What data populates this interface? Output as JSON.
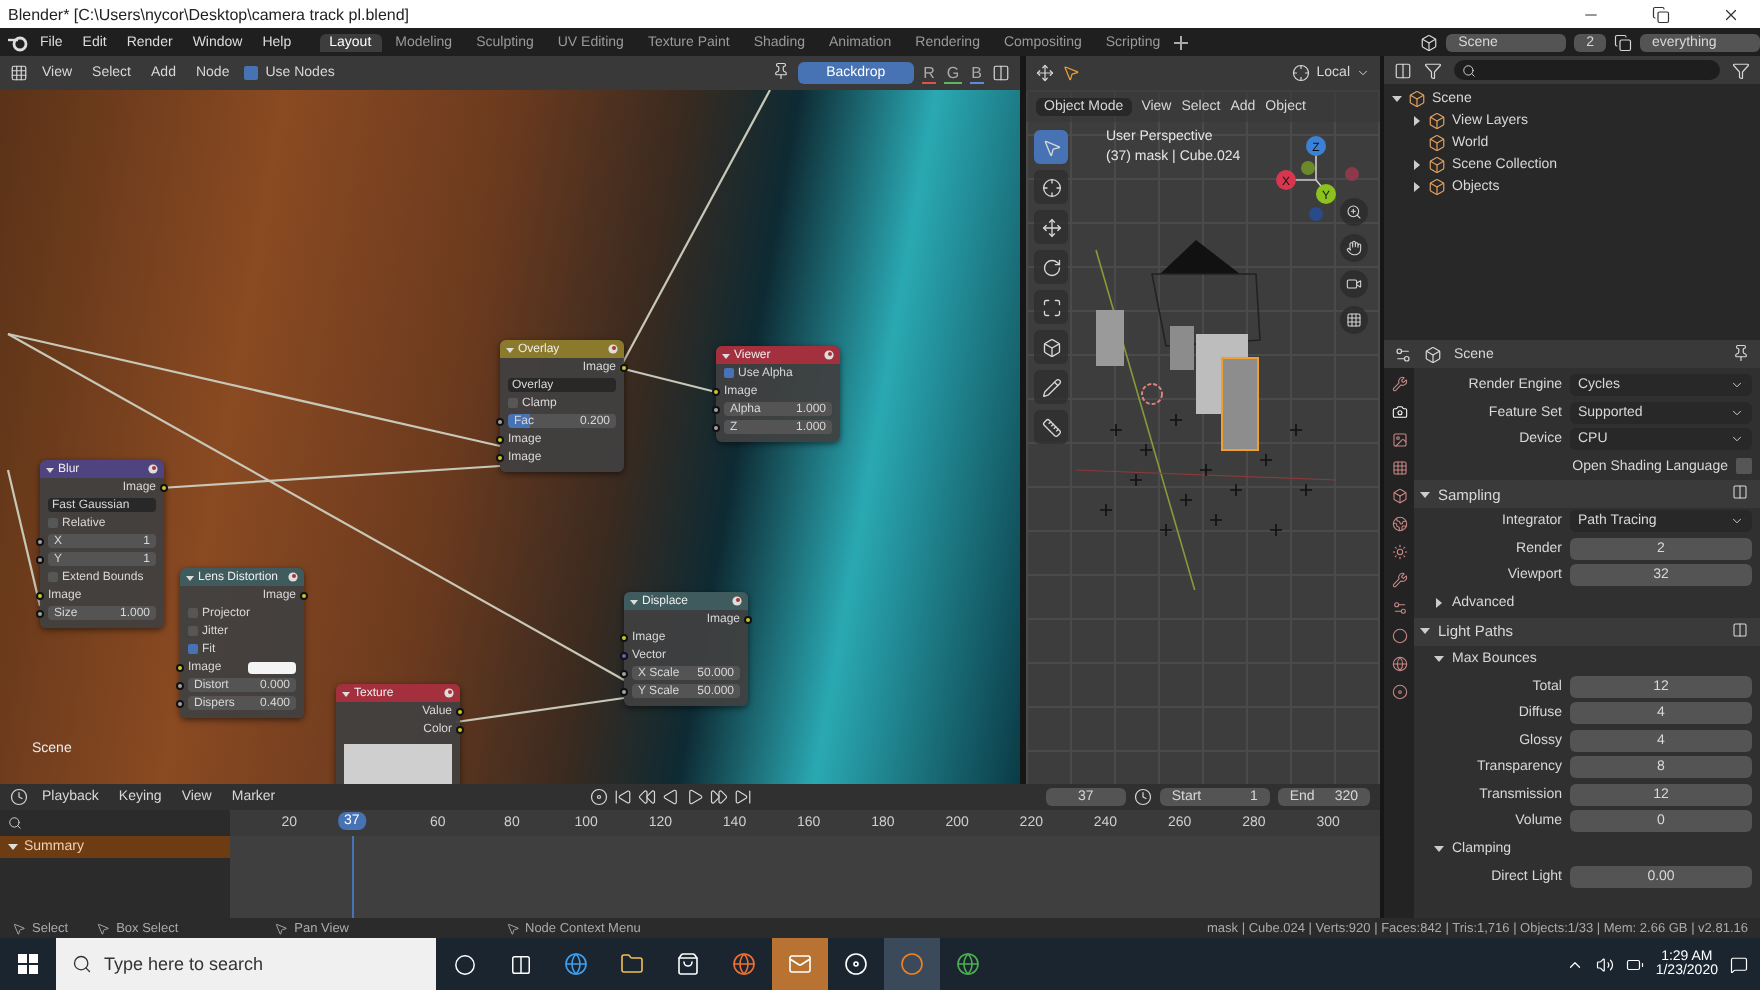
{
  "title_bar": {
    "title": "Blender* [C:\\Users\\nycor\\Desktop\\camera track pl.blend]"
  },
  "menu_bar": {
    "menus": [
      "File",
      "Edit",
      "Render",
      "Window",
      "Help"
    ],
    "workspaces": [
      {
        "label": "Layout",
        "selected": true
      },
      {
        "label": "Modeling",
        "selected": false
      },
      {
        "label": "Sculpting",
        "selected": false
      },
      {
        "label": "UV Editing",
        "selected": false
      },
      {
        "label": "Texture Paint",
        "selected": false
      },
      {
        "label": "Shading",
        "selected": false
      },
      {
        "label": "Animation",
        "selected": false
      },
      {
        "label": "Rendering",
        "selected": false
      },
      {
        "label": "Compositing",
        "selected": false
      },
      {
        "label": "Scripting",
        "selected": false
      }
    ],
    "scene": "Scene",
    "view_layer_count": "2",
    "view_layer": "everything"
  },
  "node_editor": {
    "menus": [
      "View",
      "Select",
      "Add",
      "Node"
    ],
    "use_nodes": {
      "label": "Use Nodes",
      "checked": true
    },
    "backdrop": {
      "label": "Backdrop",
      "on": true
    },
    "channels": [
      "R",
      "G",
      "B"
    ],
    "scene_label": "Scene",
    "nodes": [
      {
        "title": "Overlay",
        "color": "#8c7a2c",
        "rows": [
          {
            "kind": "output",
            "label": "Image"
          },
          {
            "kind": "select",
            "value": "Overlay"
          },
          {
            "kind": "checkbox",
            "label": "Clamp",
            "checked": false
          },
          {
            "kind": "value",
            "label": "Fac",
            "value": "0.200",
            "level": 0.2
          },
          {
            "kind": "input",
            "label": "Image"
          },
          {
            "kind": "input",
            "label": "Image"
          }
        ]
      },
      {
        "title": "Viewer",
        "color": "#a3303c",
        "rows": [
          {
            "kind": "checkbox",
            "label": "Use Alpha",
            "checked": true
          },
          {
            "kind": "input",
            "label": "Image"
          },
          {
            "kind": "value",
            "label": "Alpha",
            "value": "1.000"
          },
          {
            "kind": "value",
            "label": "Z",
            "value": "1.000"
          }
        ]
      },
      {
        "title": "Blur",
        "color": "#4f4380",
        "rows": [
          {
            "kind": "output",
            "label": "Image"
          },
          {
            "kind": "select",
            "value": "Fast Gaussian"
          },
          {
            "kind": "checkbox",
            "label": "Relative",
            "checked": false
          },
          {
            "kind": "value",
            "label": "X",
            "value": "1"
          },
          {
            "kind": "value",
            "label": "Y",
            "value": "1"
          },
          {
            "kind": "checkbox",
            "label": "Extend Bounds",
            "checked": false
          },
          {
            "kind": "input",
            "label": "Image"
          },
          {
            "kind": "value",
            "label": "Size",
            "value": "1.000"
          }
        ]
      },
      {
        "title": "Lens Distortion",
        "color": "#3f5b5d",
        "rows": [
          {
            "kind": "output",
            "label": "Image"
          },
          {
            "kind": "checkbox",
            "label": "Projector",
            "checked": false
          },
          {
            "kind": "checkbox",
            "label": "Jitter",
            "checked": false
          },
          {
            "kind": "checkbox",
            "label": "Fit",
            "checked": true
          },
          {
            "kind": "swatch",
            "label": "Image"
          },
          {
            "kind": "value",
            "label": "Distort",
            "value": "0.000"
          },
          {
            "kind": "value",
            "label": "Dispers",
            "value": "0.400"
          }
        ]
      },
      {
        "title": "Texture",
        "color": "#a3303c",
        "rows": [
          {
            "kind": "output",
            "label": "Value"
          },
          {
            "kind": "output",
            "label": "Color"
          }
        ]
      },
      {
        "title": "Displace",
        "color": "#3f5b5d",
        "rows": [
          {
            "kind": "output",
            "label": "Image"
          },
          {
            "kind": "input",
            "label": "Image"
          },
          {
            "kind": "input",
            "label": "Vector"
          },
          {
            "kind": "value",
            "label": "X Scale",
            "value": "50.000"
          },
          {
            "kind": "value",
            "label": "Y Scale",
            "value": "50.000"
          }
        ]
      }
    ]
  },
  "viewport": {
    "mode": "Object Mode",
    "menus": [
      "View",
      "Select",
      "Add",
      "Object"
    ],
    "orientation": "Local",
    "perspective": "User Perspective",
    "object_info": "(37) mask | Cube.024",
    "axes": [
      "Z",
      "X",
      "Y"
    ]
  },
  "outliner": {
    "tree": [
      {
        "label": "Scene",
        "expanded": true,
        "children": [
          {
            "label": "View Layers",
            "expanded": false
          },
          {
            "label": "World"
          },
          {
            "label": "Scene Collection",
            "expanded": false
          },
          {
            "label": "Objects",
            "expanded": false
          }
        ]
      }
    ]
  },
  "properties": {
    "context": "Scene",
    "rows": [
      {
        "kind": "select",
        "label": "Render Engine",
        "value": "Cycles"
      },
      {
        "kind": "select",
        "label": "Feature Set",
        "value": "Supported"
      },
      {
        "kind": "select",
        "label": "Device",
        "value": "CPU"
      },
      {
        "kind": "checkbox",
        "label": "Open Shading Language",
        "checked": false
      },
      {
        "kind": "panel",
        "label": "Sampling",
        "expanded": true
      },
      {
        "kind": "select",
        "label": "Integrator",
        "value": "Path Tracing"
      },
      {
        "kind": "number",
        "label": "Render",
        "value": "2"
      },
      {
        "kind": "number",
        "label": "Viewport",
        "value": "32"
      },
      {
        "kind": "subpanel",
        "label": "Advanced",
        "expanded": false
      },
      {
        "kind": "panel",
        "label": "Light Paths",
        "expanded": true
      },
      {
        "kind": "subpanel",
        "label": "Max Bounces",
        "expanded": true
      },
      {
        "kind": "number",
        "label": "Total",
        "value": "12"
      },
      {
        "kind": "number",
        "label": "Diffuse",
        "value": "4"
      },
      {
        "kind": "number",
        "label": "Glossy",
        "value": "4"
      },
      {
        "kind": "number",
        "label": "Transparency",
        "value": "8"
      },
      {
        "kind": "number",
        "label": "Transmission",
        "value": "12"
      },
      {
        "kind": "number",
        "label": "Volume",
        "value": "0"
      },
      {
        "kind": "subpanel",
        "label": "Clamping",
        "expanded": true
      },
      {
        "kind": "number",
        "label": "Direct Light",
        "value": "0.00"
      }
    ]
  },
  "timeline": {
    "menus": [
      "Playback",
      "Keying",
      "View",
      "Marker"
    ],
    "current_frame": "37",
    "start_label": "Start",
    "start": "1",
    "end_label": "End",
    "end": "320",
    "playhead": {
      "label": "37",
      "level": 0.106
    },
    "ticks": [
      "20",
      "60",
      "80",
      "100",
      "120",
      "140",
      "160",
      "180",
      "200",
      "220",
      "240",
      "260",
      "280",
      "300"
    ],
    "channels": [
      {
        "label": "Summary",
        "expanded": true
      }
    ]
  },
  "status_bar": {
    "hints": [
      "Select",
      "Box Select",
      "Pan View",
      "Node Context Menu"
    ],
    "stats": "mask | Cube.024 | Verts:920 | Faces:842 | Tris:1,716 | Objects:1/33 | Mem: 2.66 GB | v2.81.16"
  },
  "taskbar": {
    "search": {
      "placeholder": "Type here to search"
    },
    "time": "1:29 AM",
    "date": "1/23/2020"
  }
}
